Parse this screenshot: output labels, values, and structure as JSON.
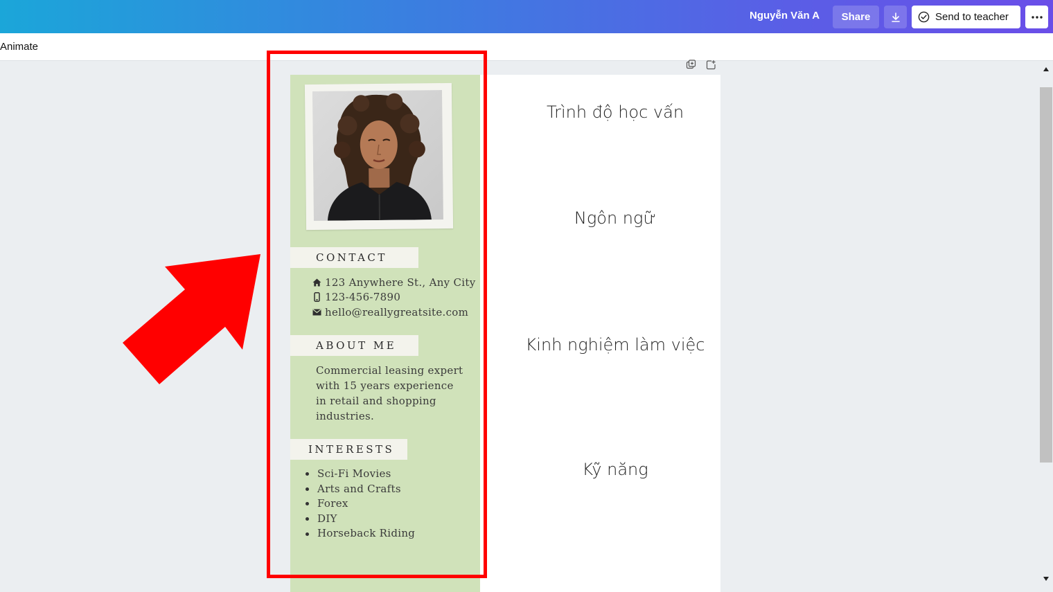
{
  "header": {
    "user_name": "Nguyễn Văn A",
    "share_label": "Share",
    "send_label": "Send to teacher",
    "gradient_colors": [
      "#1ba6d9",
      "#6a4ee8"
    ]
  },
  "toolbar": {
    "animate_label": "Animate"
  },
  "resume": {
    "sidebar_color": "#d0e2ba",
    "contact": {
      "title": "CONTACT",
      "address": "123 Anywhere St., Any City",
      "phone": "123-456-7890",
      "email": "hello@reallygreatsite.com"
    },
    "about": {
      "title": "ABOUT ME",
      "lines": [
        "Commercial leasing expert",
        "with 15 years experience",
        "in retail and shopping",
        "industries."
      ]
    },
    "interests": {
      "title": "INTERESTS",
      "items": [
        "Sci-Fi Movies",
        "Arts and Crafts",
        "Forex",
        "DIY",
        "Horseback Riding"
      ]
    },
    "headings": {
      "education": "Trình độ học vấn",
      "language": "Ngôn ngữ",
      "experience": "Kinh nghiệm làm việc",
      "skills": "Kỹ năng"
    }
  },
  "annotation": {
    "color": "#ff0000"
  }
}
